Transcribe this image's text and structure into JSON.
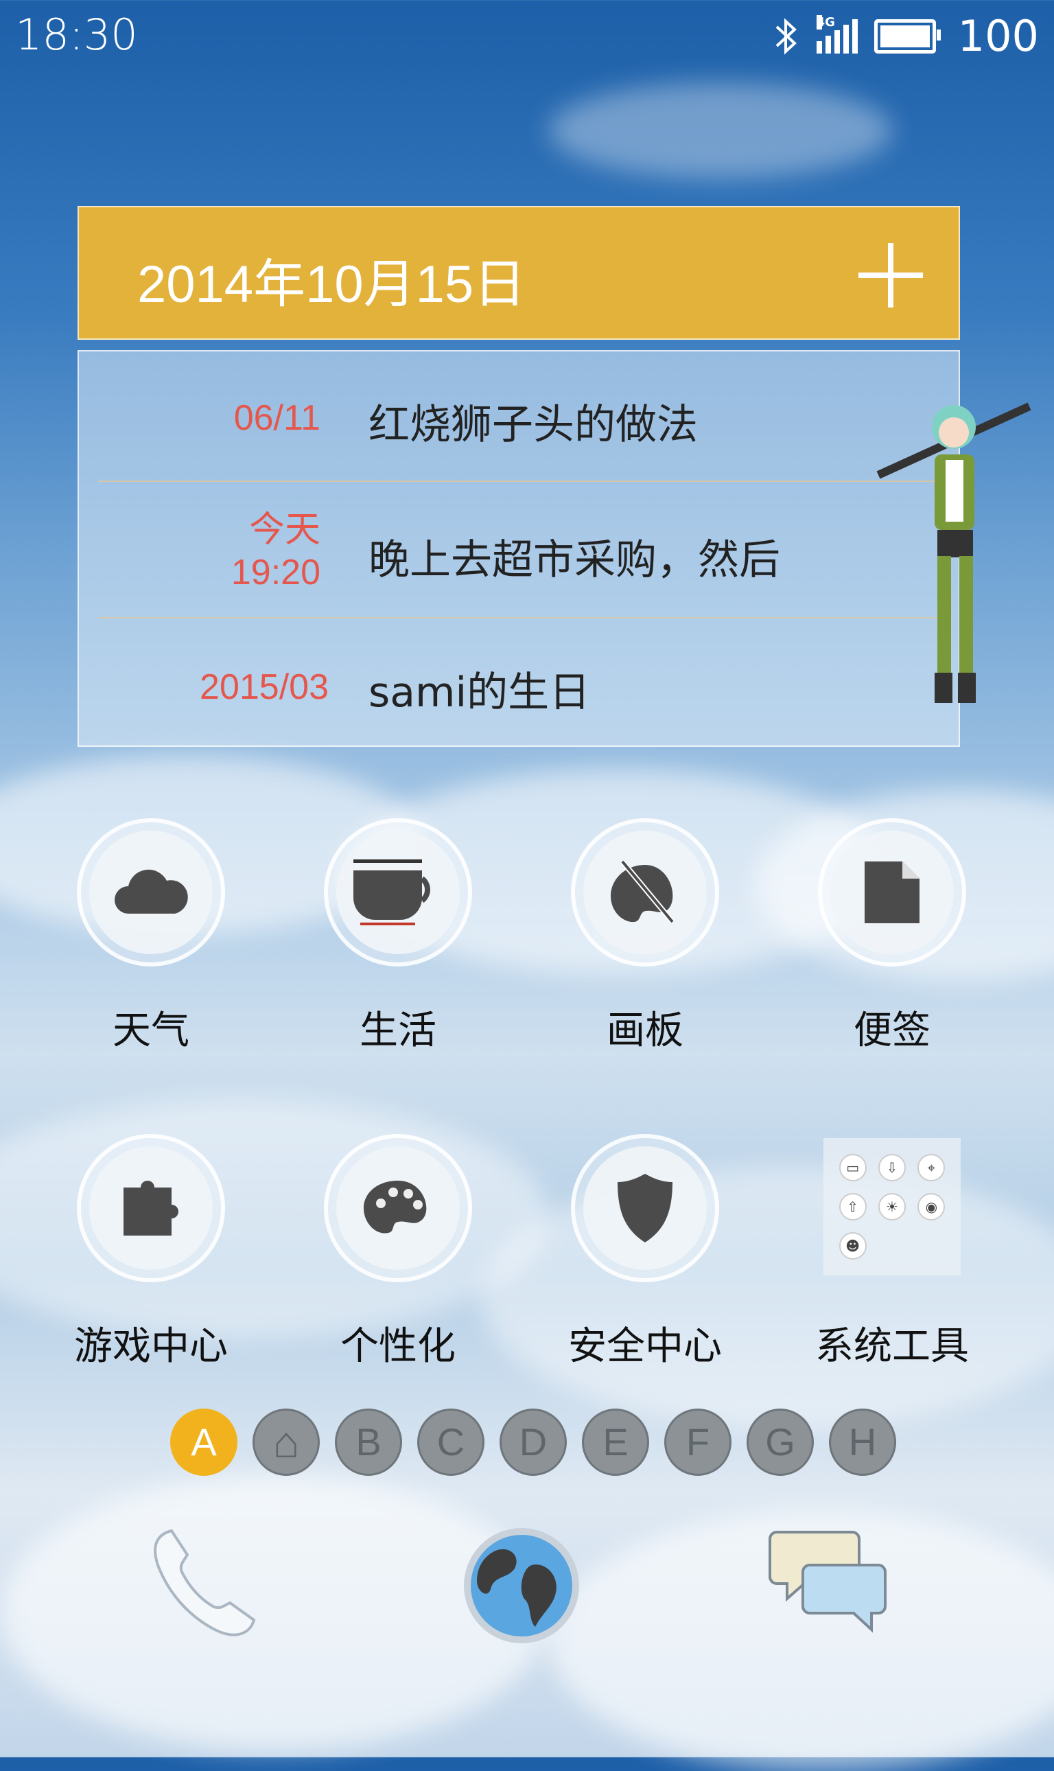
{
  "status_bar": {
    "time": "18:30",
    "battery": "100",
    "network": "4G"
  },
  "calendar": {
    "date": "2014年10月15日",
    "add_icon": "plus-icon",
    "events": [
      {
        "when": [
          "06/11"
        ],
        "title": "红烧狮子头的做法"
      },
      {
        "when": [
          "今天",
          "19:20"
        ],
        "title": "晚上去超市采购，然后"
      },
      {
        "when": [
          "2015/03"
        ],
        "title": "sami的生日"
      }
    ]
  },
  "apps": [
    {
      "label": "天气",
      "icon": "cloud-icon"
    },
    {
      "label": "生活",
      "icon": "coffee-cup-icon"
    },
    {
      "label": "画板",
      "icon": "palette-brush-icon"
    },
    {
      "label": "便签",
      "icon": "note-icon"
    },
    {
      "label": "游戏中心",
      "icon": "puzzle-icon"
    },
    {
      "label": "个性化",
      "icon": "palette-icon"
    },
    {
      "label": "安全中心",
      "icon": "shield-icon"
    },
    {
      "label": "系统工具",
      "icon": "tools-folder-icon"
    }
  ],
  "pages": [
    "A",
    "⌂",
    "B",
    "C",
    "D",
    "E",
    "F",
    "G",
    "H"
  ],
  "active_page": "A",
  "dock": [
    "phone-icon",
    "browser-globe-icon",
    "messages-icon"
  ],
  "colors": {
    "calendar_header": "#e3b23b",
    "event_time": "#e5574d",
    "active_dot": "#f2b21d"
  }
}
